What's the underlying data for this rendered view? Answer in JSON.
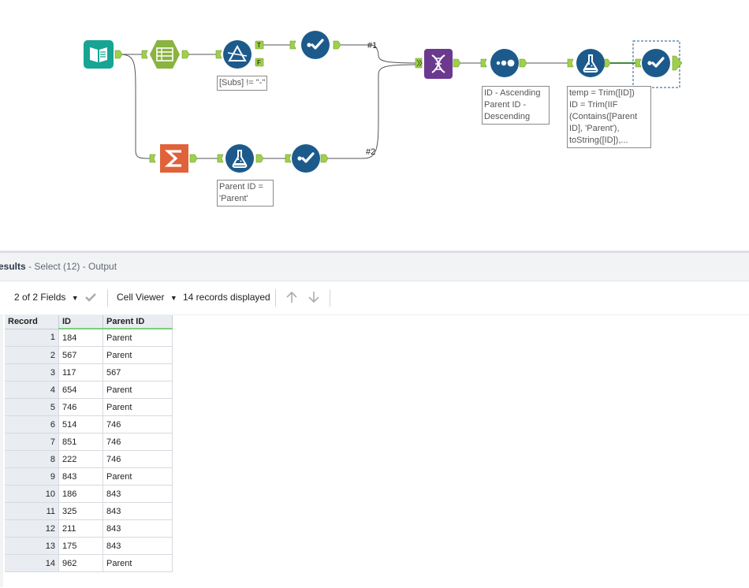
{
  "workflow": {
    "annotations": {
      "filter": "[Subs] != \"-\"",
      "formula_parent": "Parent ID =\n'Parent'",
      "sort": "ID - Ascending\nParent ID -\nDescending",
      "formula_final": "temp = Trim([ID])\nID = Trim(IIF\n(Contains([Parent\nID], 'Parent'),\ntoString([ID]),..."
    },
    "connection_labels": {
      "c1": "#1",
      "c2": "#2"
    },
    "anchor_labels": {
      "true": "T",
      "false": "F"
    },
    "colors": {
      "input": "#17a493",
      "select_records": "#8ab33f",
      "summarize": "#e0623a",
      "union": "#6b3a8f",
      "preparation": "#1d5a8c",
      "connector": "#9fd04a"
    }
  },
  "results": {
    "title": "esults",
    "subtitle": " - Select (12) - Output",
    "fields_label": "2 of 2 Fields",
    "cell_viewer_label": "Cell Viewer",
    "records_label": "14 records displayed",
    "columns": [
      "Record",
      "ID",
      "Parent ID"
    ],
    "rows": [
      [
        "1",
        "184",
        "Parent"
      ],
      [
        "2",
        "567",
        "Parent"
      ],
      [
        "3",
        "117",
        "567"
      ],
      [
        "4",
        "654",
        "Parent"
      ],
      [
        "5",
        "746",
        "Parent"
      ],
      [
        "6",
        "514",
        "746"
      ],
      [
        "7",
        "851",
        "746"
      ],
      [
        "8",
        "222",
        "746"
      ],
      [
        "9",
        "843",
        "Parent"
      ],
      [
        "10",
        "186",
        "843"
      ],
      [
        "11",
        "325",
        "843"
      ],
      [
        "12",
        "211",
        "843"
      ],
      [
        "13",
        "175",
        "843"
      ],
      [
        "14",
        "962",
        "Parent"
      ]
    ]
  }
}
